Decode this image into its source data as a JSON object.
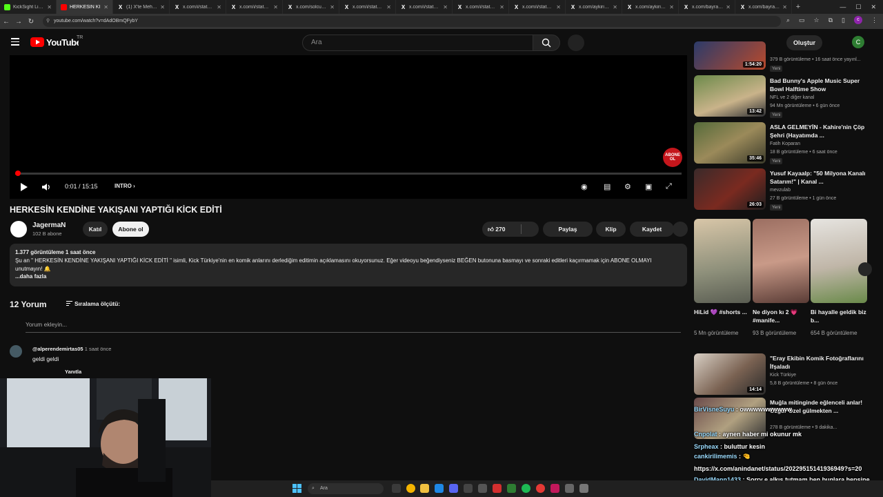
{
  "browser": {
    "tabs": [
      {
        "title": "KickSight Link De",
        "icon": "kick",
        "active": false
      },
      {
        "title": "HERKESİN KI",
        "icon": "youtube",
        "active": true
      },
      {
        "title": "(1) X'te Mehmet",
        "icon": "x",
        "active": false
      },
      {
        "title": "x.com/i/status/20",
        "icon": "x",
        "active": false
      },
      {
        "title": "x.com/i/status/20",
        "icon": "x",
        "active": false
      },
      {
        "title": "x.com/solcugaze",
        "icon": "x",
        "active": false
      },
      {
        "title": "x.com/i/status/20",
        "icon": "x",
        "active": false
      },
      {
        "title": "x.com/i/status/20",
        "icon": "x",
        "active": false
      },
      {
        "title": "x.com/i/status/20",
        "icon": "x",
        "active": false
      },
      {
        "title": "x.com/i/status/20",
        "icon": "x",
        "active": false
      },
      {
        "title": "x.com/aykiri/stat",
        "icon": "x",
        "active": false
      },
      {
        "title": "x.com/aykiri/stat",
        "icon": "x",
        "active": false
      },
      {
        "title": "x.com/bayrakme",
        "icon": "x",
        "active": false
      },
      {
        "title": "x.com/bayrakme",
        "icon": "x",
        "active": false
      }
    ],
    "url": "youtube.com/watch?v=dAdOBmQFybY"
  },
  "masthead": {
    "region": "TR",
    "search_placeholder": "Ara",
    "create_label": "Oluştur",
    "avatar_letter": "C"
  },
  "player": {
    "time": "0:01 / 15:15",
    "chapter": "INTRO",
    "progress_fraction": 0.0011,
    "badge_line1": "ABONE",
    "badge_line2": "OL"
  },
  "video": {
    "title": "HERKESİN KENDİNE YAKIŞANI YAPTIĞI KİCK EDİTİ",
    "channel": "JagermaN",
    "subscribers": "102 B abone",
    "join_label": "Katıl",
    "subscribe_label": "Abone ol",
    "likes": "270",
    "share_label": "Paylaş",
    "clip_label": "Klip",
    "save_label": "Kaydet"
  },
  "description": {
    "meta": "1.377 görüntüleme  1 saat önce",
    "text": "Şu an \" HERKESİN KENDİNE YAKIŞANI YAPTIĞI KİCK EDİTİ \" isimli, Kick Türkiye'nin en komik anlarını derlediğim editimin açıklamasını okuyorsunuz. Eğer videoyu beğendiyseniz BEĞEN butonuna basmayı ve sonraki editleri kaçırmamak için ABONE OLMAYI unutmayın! 🔔",
    "more": "...daha fazla"
  },
  "comments": {
    "count": "12 Yorum",
    "sort_label": "Sıralama ölçütü:",
    "add_placeholder": "Yorum ekleyin...",
    "items": [
      {
        "author": "@alperendemirtas05",
        "time": "1 saat önce",
        "text": "geldi geldi",
        "reply": "Yanıtla"
      }
    ]
  },
  "sidebar": {
    "videos": [
      {
        "title": "",
        "channel": "",
        "meta": "379 B görüntüleme • 16 saat önce yayınl...",
        "duration": "1:54:20",
        "badge": "Yeni"
      },
      {
        "title": "Bad Bunny's Apple Music Super Bowl Halftime Show",
        "channel": "NFL     ve 2 diğer kanal",
        "meta": "94 Mn görüntüleme • 6 gün önce",
        "duration": "13:42",
        "badge": "Yeni"
      },
      {
        "title": "ASLA GELMEYİN - Kahire'nin Çöp Şehri (Hayatımda ...",
        "channel": "Fatih Koparan",
        "meta": "18 B görüntüleme • 6 saat önce",
        "duration": "35:46",
        "badge": "Yeni"
      },
      {
        "title": "Yusuf Kayaalp: \"50 Milyona Kanalı Satarım!\" | Kanal ...",
        "channel": "mevzulab",
        "meta": "27 B görüntüleme • 1 gün önce",
        "duration": "26:03",
        "badge": "Yeni"
      },
      {
        "title": "\"Eray Ekibin Komik Fotoğraflarını İfşaladı",
        "channel": "Kick Türkiye",
        "meta": "5,8 B görüntüleme • 8 gün önce",
        "duration": "14:14",
        "badge": ""
      },
      {
        "title": "Muğla mitinginde eğlenceli anlar! Özgür Özel gülmekten ...",
        "channel": "",
        "meta": "278 B görüntüleme • 9 dakika...",
        "duration": "",
        "badge": ""
      }
    ],
    "shorts": [
      {
        "title": "HiLid 💜 #shorts ...",
        "views": "5 Mn görüntüleme"
      },
      {
        "title": "Ne diyon kı 2 💗#manife...",
        "views": "93 B görüntüleme"
      },
      {
        "title": "Bi hayalle geldik biz b...",
        "views": "654 B görüntüleme"
      }
    ]
  },
  "chat": [
    {
      "user": "BirVisneSuyu",
      "text": " : owwwwwwwwww"
    },
    {
      "user": "Cnpolat",
      "text": " : aynen haber mi okunur mk"
    },
    {
      "user": "Srpheax",
      "text": " : buluttur kesin"
    },
    {
      "user": "cankirilimemis",
      "text": " : 🤏"
    },
    {
      "user": "",
      "text": "https://x.com/anindanet/status/20229515141936949?s=20"
    },
    {
      "user": "DavidMann1433",
      "text": " : Sorry e alkış tutmam ben bunlara hepsine kılım"
    }
  ],
  "taskbar": {
    "search_placeholder": "Ara"
  }
}
